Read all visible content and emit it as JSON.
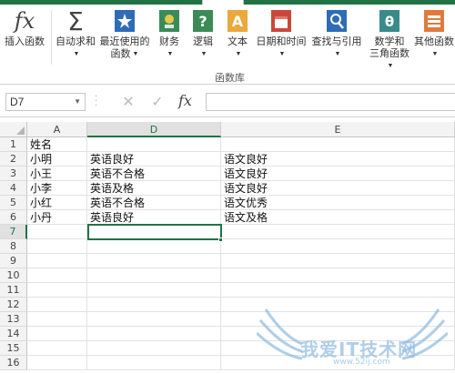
{
  "ribbon": {
    "insert_function": "插入函数",
    "autosum": "自动求和",
    "recent_line1": "最近使用的",
    "recent_line2": "函数",
    "financial": "财务",
    "logical": "逻辑",
    "text": "文本",
    "datetime": "日期和时间",
    "lookup": "查找与引用",
    "math_line1": "数学和",
    "math_line2": "三角函数",
    "more": "其他函数",
    "group_label": "函数库"
  },
  "formula_bar": {
    "name_box": "D7",
    "fx": "fx",
    "value": ""
  },
  "columns": [
    "A",
    "D",
    "E"
  ],
  "rows": [
    "1",
    "2",
    "3",
    "4",
    "5",
    "6",
    "7",
    "8",
    "9",
    "10",
    "11",
    "12",
    "13",
    "14",
    "15",
    "16"
  ],
  "cells": {
    "A": [
      "姓名",
      "小明",
      "小王",
      "小李",
      "小红",
      "小丹"
    ],
    "D": [
      "",
      "英语良好",
      "英语不合格",
      "英语及格",
      "英语不合格",
      "英语良好"
    ],
    "E": [
      "",
      "语文良好",
      "语文良好",
      "语文良好",
      "语文优秀",
      "语文及格"
    ]
  },
  "active_cell": "D7",
  "colors": {
    "accent": "#217346"
  },
  "watermark": {
    "text": "我爱IT技术网",
    "url": "www.52ij.com"
  }
}
